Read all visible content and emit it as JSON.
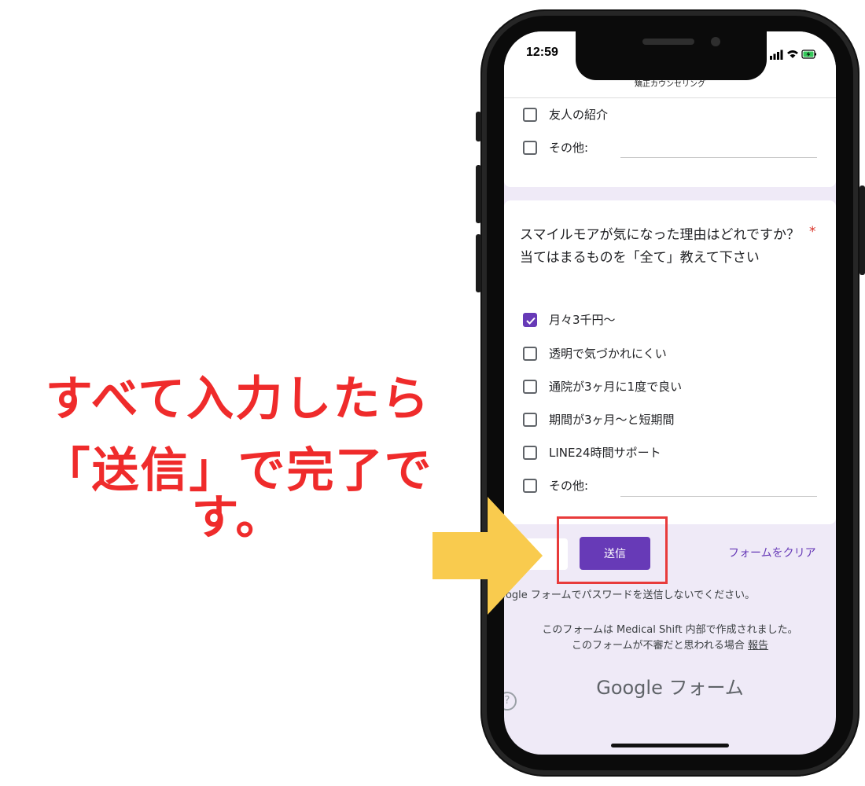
{
  "annotation": {
    "line1": "すべて入力したら",
    "line2": "「送信」で完了です。"
  },
  "status_bar": {
    "time": "12:59"
  },
  "form": {
    "title": "矯正カウンセリング",
    "prev_options": [
      {
        "label": "友人の紹介",
        "checked": false
      },
      {
        "label": "その他:",
        "checked": false,
        "other": true
      }
    ],
    "question": {
      "text": "スマイルモアが気になった理由はどれですか？当てはまるものを「全て」教えて下さい",
      "required_mark": "*",
      "options": [
        {
          "label": "月々3千円〜",
          "checked": true
        },
        {
          "label": "透明で気づかれにくい",
          "checked": false
        },
        {
          "label": "通院が3ヶ月に1度で良い",
          "checked": false
        },
        {
          "label": "期間が3ヶ月〜と短期間",
          "checked": false
        },
        {
          "label": "LINE24時間サポート",
          "checked": false
        },
        {
          "label": "その他:",
          "checked": false,
          "other": true
        }
      ]
    },
    "submit_label": "送信",
    "clear_label": "フォームをクリア",
    "password_notice": "oogle フォームでパスワードを送信しないでください。",
    "footer_line1": "このフォームは Medical Shift 内部で作成されました。",
    "footer_line2": "このフォームが不審だと思われる場合",
    "report_link": "報告",
    "brand": "Google フォーム",
    "help": "?"
  },
  "colors": {
    "accent": "#673ab7",
    "annotation": "#ef2b2b",
    "arrow": "#f9cb4e",
    "highlight_box": "#e83b3b"
  },
  "icons": [
    "check-icon",
    "signal-icon",
    "wifi-icon",
    "battery-icon",
    "arrow-right-icon",
    "help-icon"
  ]
}
